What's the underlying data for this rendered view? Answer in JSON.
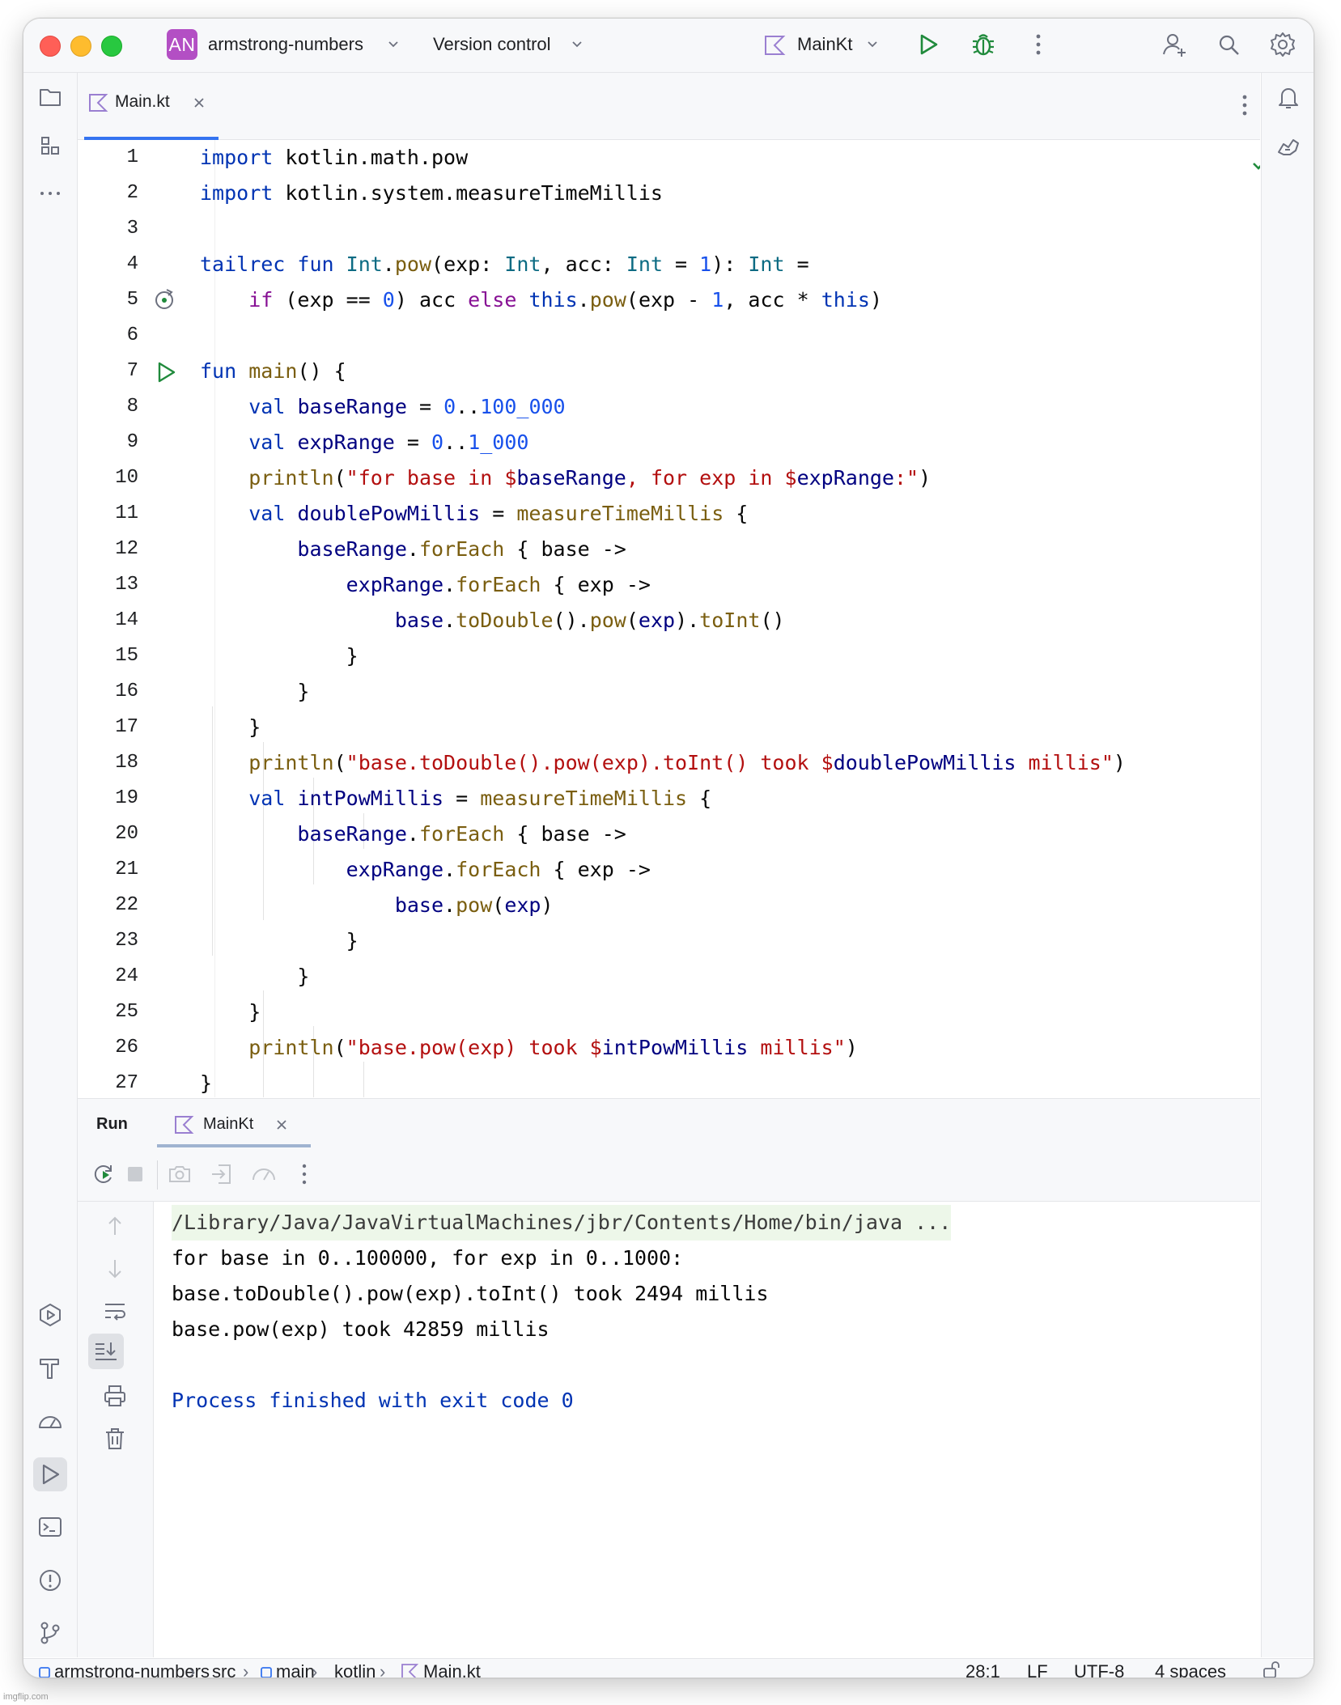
{
  "titlebar": {
    "project_badge": "AN",
    "project_name": "armstrong-numbers",
    "vcs_menu": "Version control",
    "run_config": "MainKt",
    "badge_color": "#b34fc4"
  },
  "editor": {
    "tab_label": "Main.kt",
    "lines": [
      {
        "n": "1",
        "html": "<span class='t-kw'>import</span> kotlin.math.pow"
      },
      {
        "n": "2",
        "html": "<span class='t-kw'>import</span> kotlin.system.measureTimeMillis"
      },
      {
        "n": "3",
        "html": ""
      },
      {
        "n": "4",
        "html": "<span class='t-kw'>tailrec</span> <span class='t-kw'>fun</span> <span class='t-type'>Int</span>.<span class='t-call'>pow</span>(exp: <span class='t-type'>Int</span>, acc: <span class='t-type'>Int</span> = <span class='t-num'>1</span>): <span class='t-type'>Int</span> ="
      },
      {
        "n": "5",
        "html": "    <span class='t-kw2'>if</span> (exp == <span class='t-num'>0</span>) acc <span class='t-kw2'>else</span> <span class='t-kw'>this</span>.<span class='t-call'>pow</span>(exp - <span class='t-num'>1</span>, acc * <span class='t-kw'>this</span>)"
      },
      {
        "n": "6",
        "html": ""
      },
      {
        "n": "7",
        "html": "<span class='t-kw'>fun</span> <span class='t-call'>main</span>() {"
      },
      {
        "n": "8",
        "html": "    <span class='t-kw'>val</span> <span class='t-var'>baseRange</span> = <span class='t-num'>0</span>..<span class='t-num'>100_000</span>"
      },
      {
        "n": "9",
        "html": "    <span class='t-kw'>val</span> <span class='t-var'>expRange</span> = <span class='t-num'>0</span>..<span class='t-num'>1_000</span>"
      },
      {
        "n": "10",
        "html": "    <span class='t-call'>println</span>(<span class='t-str'>\"for base in </span><span class='t-str'>$</span><span class='t-var'>baseRange</span><span class='t-str'>, for exp in </span><span class='t-str'>$</span><span class='t-var'>expRange</span><span class='t-str'>:\"</span>)"
      },
      {
        "n": "11",
        "html": "    <span class='t-kw'>val</span> <span class='t-var'>doublePowMillis</span> = <span class='t-call'>measureTimeMillis</span> {"
      },
      {
        "n": "12",
        "html": "        <span class='t-var'>baseRange</span>.<span class='t-call'>forEach</span> { base ->"
      },
      {
        "n": "13",
        "html": "            <span class='t-var'>expRange</span>.<span class='t-call'>forEach</span> { exp ->"
      },
      {
        "n": "14",
        "html": "                <span class='t-var'>base</span>.<span class='t-call'>toDouble</span>().<span class='t-call'>pow</span>(<span class='t-var'>exp</span>).<span class='t-call'>toInt</span>()"
      },
      {
        "n": "15",
        "html": "            }"
      },
      {
        "n": "16",
        "html": "        }"
      },
      {
        "n": "17",
        "html": "    }"
      },
      {
        "n": "18",
        "html": "    <span class='t-call'>println</span>(<span class='t-str'>\"base.toDouble().pow(exp).toInt() took </span><span class='t-str'>$</span><span class='t-var'>doublePowMillis</span><span class='t-str'> millis\"</span>)"
      },
      {
        "n": "19",
        "html": "    <span class='t-kw'>val</span> <span class='t-var'>intPowMillis</span> = <span class='t-call'>measureTimeMillis</span> {"
      },
      {
        "n": "20",
        "html": "        <span class='t-var'>baseRange</span>.<span class='t-call'>forEach</span> { base ->"
      },
      {
        "n": "21",
        "html": "            <span class='t-var'>expRange</span>.<span class='t-call'>forEach</span> { exp ->"
      },
      {
        "n": "22",
        "html": "                <span class='t-var'>base</span>.<span class='t-call'>pow</span>(<span class='t-var'>exp</span>)"
      },
      {
        "n": "23",
        "html": "            }"
      },
      {
        "n": "24",
        "html": "        }"
      },
      {
        "n": "25",
        "html": "    }"
      },
      {
        "n": "26",
        "html": "    <span class='t-call'>println</span>(<span class='t-str'>\"base.pow(exp) took </span><span class='t-str'>$</span><span class='t-var'>intPowMillis</span><span class='t-str'> millis\"</span>)"
      },
      {
        "n": "27",
        "html": "}"
      }
    ]
  },
  "run_panel": {
    "title": "Run",
    "tab_label": "MainKt",
    "output": [
      "/Library/Java/JavaVirtualMachines/jbr/Contents/Home/bin/java ...",
      "for base in 0..100000, for exp in 0..1000:",
      "base.toDouble().pow(exp).toInt() took 2494 millis",
      "base.pow(exp) took 42859 millis",
      "",
      "Process finished with exit code 0"
    ]
  },
  "statusbar": {
    "breadcrumbs": [
      "armstrong-numbers",
      "src",
      "main",
      "kotlin",
      "Main.kt"
    ],
    "cursor": "28:1",
    "line_sep": "LF",
    "encoding": "UTF-8",
    "indent": "4 spaces"
  },
  "watermark": "imgflip.com"
}
